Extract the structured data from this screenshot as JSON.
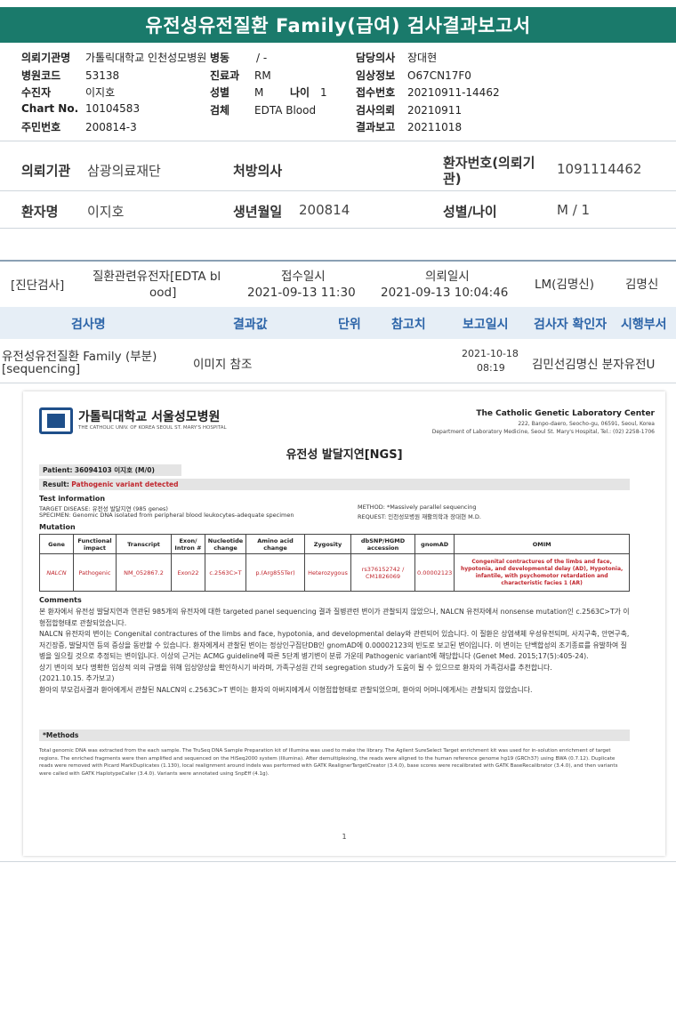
{
  "title": "유전성유전질환 Family(급여) 검사결과보고서",
  "header": {
    "left": [
      {
        "k": "의뢰기관명",
        "v": "가톨릭대학교 인천성모병원"
      },
      {
        "k": "병원코드",
        "v": "53138"
      },
      {
        "k": "수진자",
        "v": "이지호"
      },
      {
        "k": "Chart No.",
        "v": "10104583"
      },
      {
        "k": "주민번호",
        "v": "200814-3"
      }
    ],
    "mid": {
      "ward_k": "병동",
      "ward_v": "/ -",
      "dept_k": "진료과",
      "dept_v": "RM",
      "sex_k": "성별",
      "sex_v": "M",
      "age_k": "나이",
      "age_v": "1",
      "specimen_k": "검체",
      "specimen_v": "EDTA Blood"
    },
    "right": [
      {
        "k": "담당의사",
        "v": "장대현"
      },
      {
        "k": "임상정보",
        "v": "O67CN17F0"
      },
      {
        "k": "접수번호",
        "v": "20210911-14462"
      },
      {
        "k": "검사의뢰",
        "v": "20210911"
      },
      {
        "k": "결과보고",
        "v": "20211018"
      }
    ]
  },
  "patient": {
    "inst_k": "의뢰기관",
    "inst_v": "삼광의료재단",
    "doctor_k": "처방의사",
    "doctor_v": "",
    "pno_k1": "환자번호(의뢰기",
    "pno_k2": "관)",
    "pno_v": "1091114462",
    "name_k": "환자명",
    "name_v": "이지호",
    "birth_k": "생년월일",
    "birth_v": "200814",
    "sexage_k": "성별/나이",
    "sexage_v": "M / 1"
  },
  "diag": {
    "type": "[진단검사]",
    "name1": "질환관련유전자[EDTA bl",
    "name2": "ood]",
    "recv_k": "접수일시",
    "recv_v": "2021-09-13  11:30",
    "req_k": "의뢰일시",
    "req_v": "2021-09-13  10:04:46",
    "lm": "LM(김명신)",
    "doctor": "김명신"
  },
  "table": {
    "headers": [
      "검사명",
      "결과값",
      "단위",
      "참고치",
      "보고일시",
      "검사자 확인자",
      "시행부서"
    ],
    "row": {
      "name1": "유전성유전질환 Family (부분)",
      "name2": "[sequencing]",
      "result": "이미지 참조",
      "date": "2021-10-18",
      "time": "08:19",
      "staff": "김민선김명신 분자유전U"
    }
  },
  "report": {
    "hosp_ko": "가톨릭대학교 서울성모병원",
    "hosp_en": "THE CATHOLIC UNIV. OF KOREA SEOUL ST. MARY'S HOSPITAL",
    "center": "The Catholic Genetic Laboratory Center",
    "addr": "222, Banpo-daero, Seocho-gu, 06591, Seoul, Korea",
    "addr2": "Department of Laboratory Medicine, Seoul St. Mary's Hospital, Tel.: (02) 2258-1706",
    "title": "유전성 발달지연[NGS]",
    "patient_k": "Patient:",
    "patient_v": "36094103 이지호 (M/0)",
    "result_k": "Result:",
    "result_v": "Pathogenic variant detected",
    "test_info": "Test information",
    "target": "TARGET DISEASE: 유전성 발달지연 (985 genes)",
    "specimen": "SPECIMEN: Genomic DNA isolated from peripheral blood leukocytes-adequate specimen",
    "method": "METHOD: *Massively parallel sequencing",
    "request": "REQUEST: 인천성모병원 재활의학과 장대현 M.D.",
    "mutation": "Mutation",
    "mut_headers": [
      "Gene",
      "Functional impact",
      "Transcript",
      "Exon/ Intron #",
      "Nucleotide change",
      "Amino acid change",
      "Zygosity",
      "dbSNP/HGMD accession",
      "gnomAD",
      "OMIM"
    ],
    "mut_row": [
      "NALCN",
      "Pathogenic",
      "NM_052867.2",
      "Exon22",
      "c.2563C>T",
      "p.(Arg855Ter)",
      "Heterozygous",
      "rs376152742 / CM1826069",
      "0.00002123",
      "Congenital contractures of the limbs and face, hypotonia, and developmental delay (AD), Hypotonia, infantile, with psychomotor retardation and characteristic facies 1 (AR)"
    ],
    "comments_title": "Comments",
    "comments": [
      "본 환자에서 유전성 발달지연과 연관된 985개의 유전자에 대한 targeted panel sequencing 결과 질병관련 변이가 관찰되지 않았으나, NALCN 유전자에서 nonsense mutation인 c.2563C>T가 이형접합형태로 관찰되었습니다.",
      "NALCN 유전자의 변이는 Congenital contractures of the limbs and face, hypotonia, and developmental delay와 관련되어 있습니다. 이 질환은 상염색체 우성유전되며, 사지구축, 안면구축, 저긴장증, 발달지연 등의 증상을 동반할 수 있습니다. 환자에게서 관찰된 변이는 정상인구집단DB인 gnomAD에 0.00002123의 빈도로 보고된 변이입니다. 이 변이는 단백합성의 조기종료를 유발하여 질병을 일으킬 것으로 추정되는 변이입니다. 이상의 근거는 ACMG guideline에 따른 5단계 병기변이 분류 가운데 Pathogenic variant에 해당합니다 (Genet Med. 2015;17(5):405-24).",
      "상기 변이의 보다 명확한 임상적 의의 규명을 위해 임상양상을 확인하시기 바라며, 가족구성원 간의 segregation study가 도움이 될 수 있으므로 환자의 가족검사를 추천합니다.",
      "(2021.10.15. 추가보고)",
      "환아의 부모검사결과 환아에게서 관찰된 NALCN의 c.2563C>T 변이는 환자의 아버지에게서 이형접합형태로 관찰되었으며, 환아의 어머니에게서는 관찰되지 않았습니다."
    ],
    "methods_title": "*Methods",
    "methods": "Total genomic DNA was extracted from the each sample. The TruSeq DNA Sample Preparation kit of Illumina was used to make the library. The Agilent SureSelect Target enrichment kit was used for in-solution enrichment of target regions. The enriched fragments were then amplified and sequenced on the HiSeq2000 system (Illumina). After demultiplexing, the reads were aligned to the human reference genome hg19 (GRCh37) using BWA (0.7.12). Duplicate reads were removed with Picard MarkDuplicates (1.130), local realignment around indels was performed with GATK RealignerTargetCreator (3.4.0), base scores were recalibrated with GATK BaseRecalibrator (3.4.0), and then variants were called with GATK HaplotypeCaller (3.4.0). Variants were annotated using SnpEff (4.1g).",
    "page": "1"
  }
}
